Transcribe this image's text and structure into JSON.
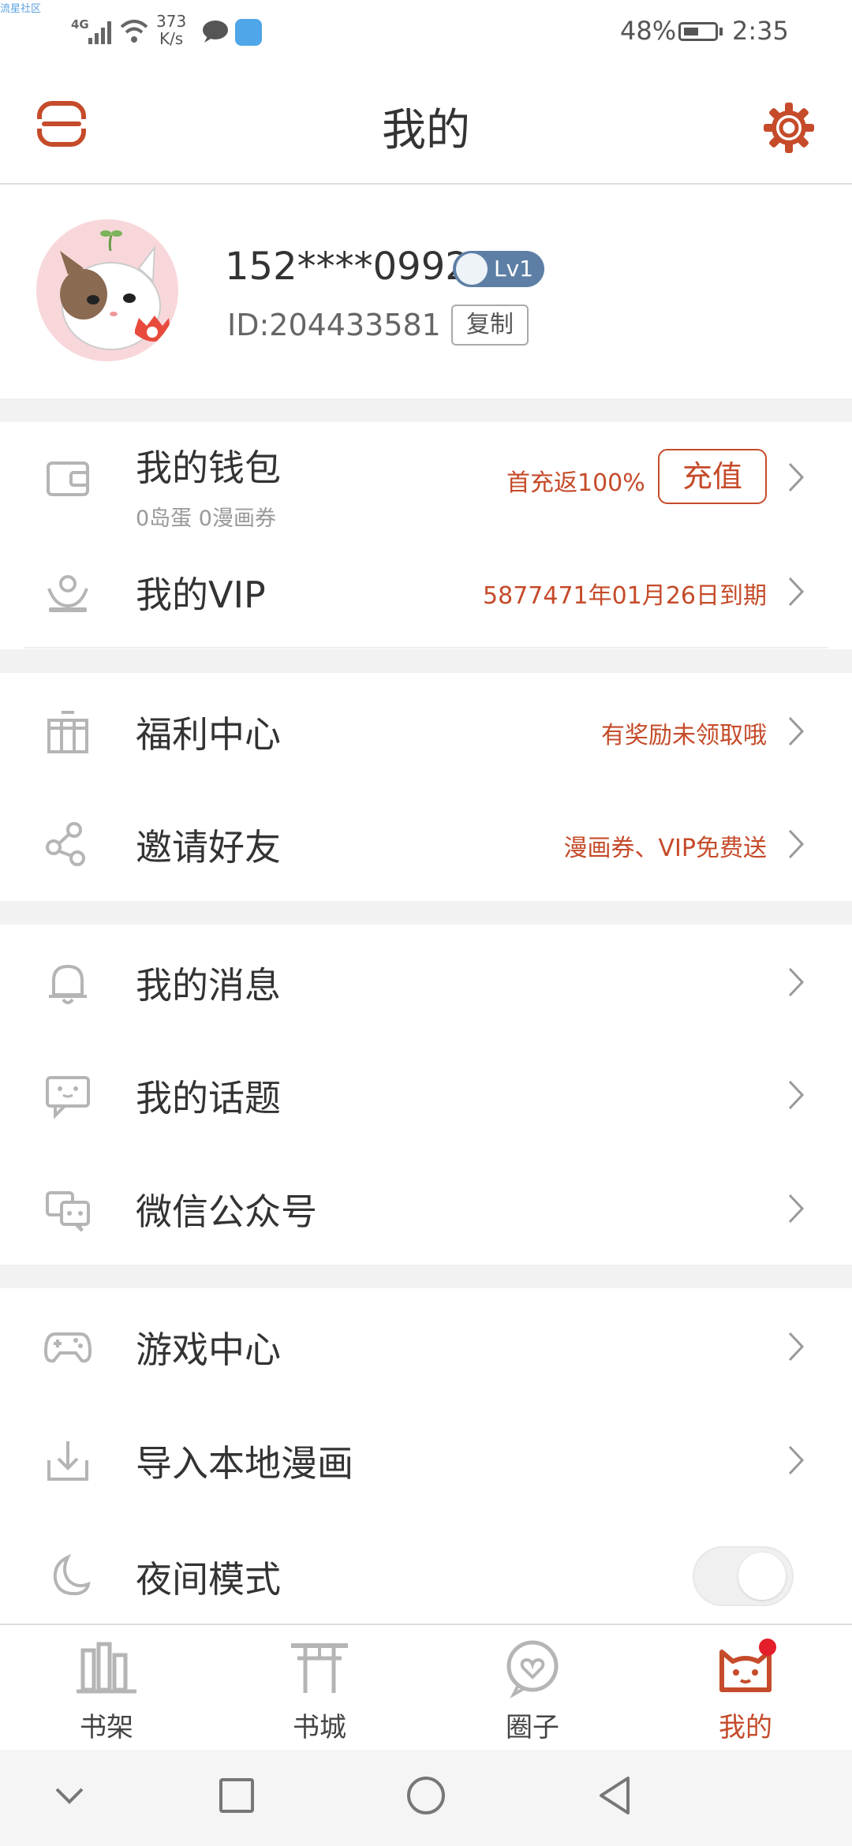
{
  "watermark": "流星社区",
  "status_bar": {
    "network": "4G",
    "speed": "373\nK/s",
    "battery": "48%",
    "time": "2:35"
  },
  "header": {
    "title": "我的"
  },
  "profile": {
    "phone": "152****0992",
    "level": "Lv1",
    "user_id": "ID:204433581",
    "copy_label": "复制"
  },
  "wallet": {
    "label": "我的钱包",
    "sub": "0岛蛋 0漫画券",
    "promo": "首充返100%",
    "recharge_label": "充值"
  },
  "vip": {
    "label": "我的VIP",
    "note": "5877471年01月26日到期"
  },
  "welfare": {
    "label": "福利中心",
    "note": "有奖励未领取哦"
  },
  "invite": {
    "label": "邀请好友",
    "note": "漫画券、VIP免费送"
  },
  "messages": {
    "label": "我的消息"
  },
  "topics": {
    "label": "我的话题"
  },
  "wechat": {
    "label": "微信公众号"
  },
  "games": {
    "label": "游戏中心"
  },
  "import": {
    "label": "导入本地漫画"
  },
  "night": {
    "label": "夜间模式"
  },
  "nav": {
    "shelf": "书架",
    "store": "书城",
    "circle": "圈子",
    "mine": "我的"
  },
  "colors": {
    "accent": "#c54b2a",
    "icon_gray": "#b5b5b5"
  }
}
